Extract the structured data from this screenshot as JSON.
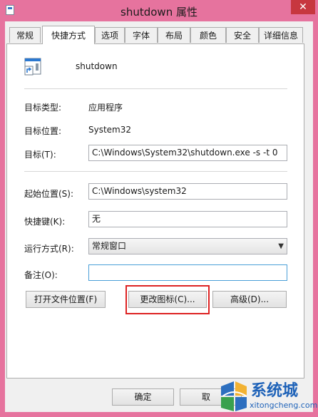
{
  "window": {
    "title": "shutdown 属性",
    "close_glyph": "✕"
  },
  "tabs": [
    {
      "label": "常规"
    },
    {
      "label": "快捷方式",
      "active": true
    },
    {
      "label": "选项"
    },
    {
      "label": "字体"
    },
    {
      "label": "布局"
    },
    {
      "label": "颜色"
    },
    {
      "label": "安全"
    },
    {
      "label": "详细信息"
    }
  ],
  "shortcut": {
    "name": "shutdown"
  },
  "info": {
    "target_type_label": "目标类型:",
    "target_type_value": "应用程序",
    "target_location_label": "目标位置:",
    "target_location_value": "System32"
  },
  "fields": {
    "target_label": "目标(T):",
    "target_value": "C:\\Windows\\System32\\shutdown.exe -s -t 0",
    "start_in_label": "起始位置(S):",
    "start_in_value": "C:\\Windows\\system32",
    "hotkey_label": "快捷键(K):",
    "hotkey_value": "无",
    "run_label": "运行方式(R):",
    "run_value": "常规窗口",
    "comment_label": "备注(O):",
    "comment_value": ""
  },
  "buttons": {
    "open_location": "打开文件位置(F)",
    "change_icon": "更改图标(C)...",
    "advanced": "高级(D)...",
    "ok": "确定",
    "cancel_partial": "取"
  },
  "watermark": {
    "brand": "系统城",
    "url": "xitongcheng.com"
  },
  "colors": {
    "desktop": "#e6739e",
    "highlight_box": "#dd2222",
    "brand": "#1e62b8"
  }
}
